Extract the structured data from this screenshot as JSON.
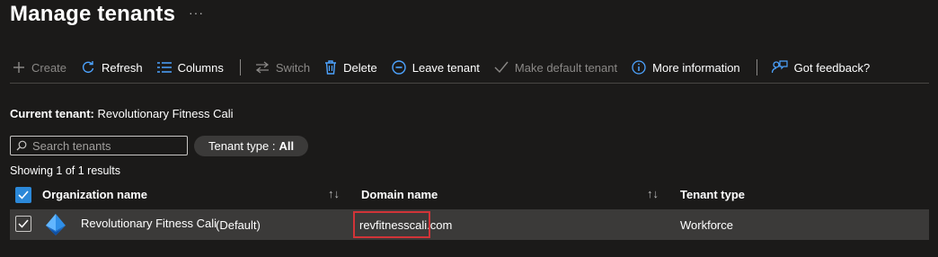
{
  "page": {
    "title": "Manage tenants",
    "more": "···"
  },
  "toolbar": {
    "create": "Create",
    "refresh": "Refresh",
    "columns": "Columns",
    "switch": "Switch",
    "delete": "Delete",
    "leave": "Leave tenant",
    "make_default": "Make default tenant",
    "more_info": "More information",
    "feedback": "Got feedback?"
  },
  "current_tenant": {
    "label": "Current tenant:",
    "value": "Revolutionary Fitness Cali"
  },
  "search": {
    "placeholder": "Search tenants",
    "value": ""
  },
  "filter": {
    "label": "Tenant type :",
    "value": "All"
  },
  "results": {
    "text": "Showing 1 of 1 results"
  },
  "table": {
    "columns": [
      "Organization name",
      "Domain name",
      "Tenant type"
    ],
    "rows": [
      {
        "org": "Revolutionary Fitness Cali",
        "tag": "(Default)",
        "domain": "revfitnesscali.com",
        "type": "Workforce"
      }
    ]
  },
  "colors": {
    "accent": "#2b88d8",
    "highlight": "#d13438",
    "background": "#1b1a19"
  }
}
